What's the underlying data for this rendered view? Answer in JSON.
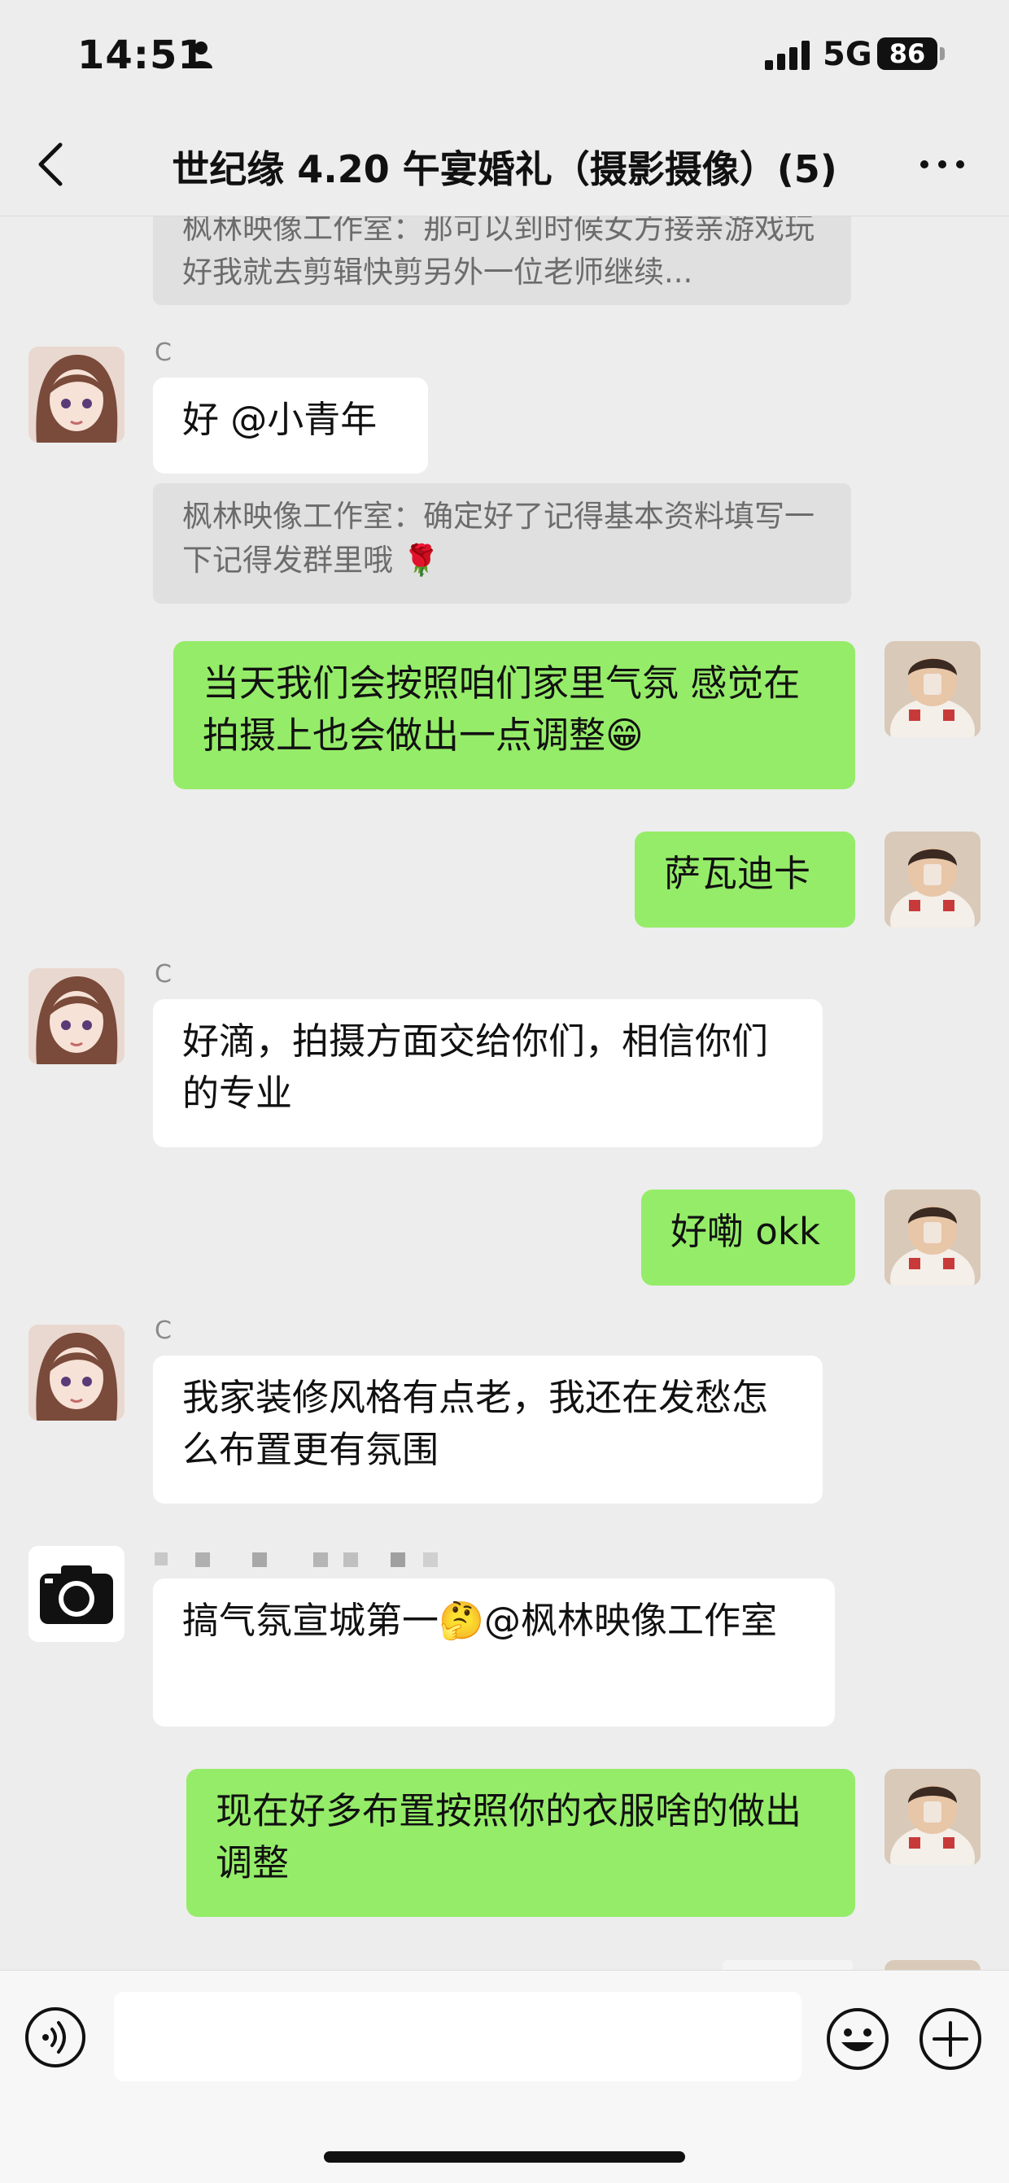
{
  "status_bar": {
    "time": "14:51",
    "network": "5G",
    "battery": "86"
  },
  "header": {
    "title": "世纪缘 4.20 午宴婚礼（摄影摄像）(5)"
  },
  "messages": [
    {
      "type": "quote",
      "text": "枫林映像工作室：那可以到时候女方接亲游戏玩好我就去剪辑快剪另外一位老师继续..."
    },
    {
      "type": "in",
      "sender": "C",
      "text": "好 @小青年"
    },
    {
      "type": "quote",
      "text": "枫林映像工作室：确定好了记得基本资料填写一下记得发群里哦 🌹"
    },
    {
      "type": "out",
      "text": "当天我们会按照咱们家里气氛 感觉在拍摄上也会做出一点调整😁"
    },
    {
      "type": "out",
      "text": "萨瓦迪卡"
    },
    {
      "type": "in",
      "sender": "C",
      "text": "好滴，拍摄方面交给你们，相信你们的专业"
    },
    {
      "type": "out",
      "text": "好嘞 okk"
    },
    {
      "type": "in",
      "sender": "C",
      "text": "我家装修风格有点老，我还在发愁怎么布置更有氛围"
    },
    {
      "type": "in",
      "sender": "",
      "text": "搞气氛宣城第一🤔@枫林映像工作室"
    },
    {
      "type": "out",
      "text": "现在好多布置按照你的衣服啥的做出调整"
    }
  ],
  "input": {
    "placeholder": ""
  },
  "icons": {
    "back": "chevron-left-icon",
    "more": "more-dots-icon",
    "voice": "voice-icon",
    "emoji": "emoji-icon",
    "plus": "plus-icon"
  },
  "colors": {
    "out_bubble": "#95ec69",
    "in_bubble": "#ffffff",
    "background": "#ededed"
  }
}
